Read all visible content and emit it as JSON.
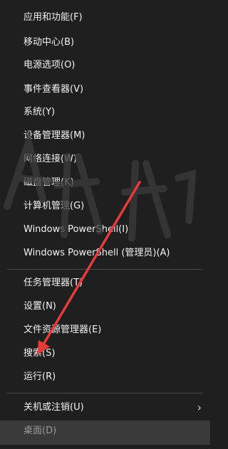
{
  "menu": {
    "items": [
      {
        "label": "应用和功能(F)"
      },
      {
        "label": "移动中心(B)"
      },
      {
        "label": "电源选项(O)"
      },
      {
        "label": "事件查看器(V)"
      },
      {
        "label": "系统(Y)"
      },
      {
        "label": "设备管理器(M)"
      },
      {
        "label": "网络连接(W)"
      },
      {
        "label": "磁盘管理(K)"
      },
      {
        "label": "计算机管理(G)"
      },
      {
        "label": "Windows PowerShell(I)"
      },
      {
        "label": "Windows PowerShell (管理员)(A)"
      },
      {
        "label": "任务管理器(T)"
      },
      {
        "label": "设置(N)"
      },
      {
        "label": "文件资源管理器(E)"
      },
      {
        "label": "搜索(S)"
      },
      {
        "label": "运行(R)"
      },
      {
        "label": "关机或注销(U)"
      },
      {
        "label": "桌面(D)"
      }
    ]
  },
  "colors": {
    "background": "#1f1f1f",
    "text": "#f2f2f2",
    "separator": "#4a4a4a",
    "highlight_bar": "#3a3a3a",
    "annotation_arrow": "#e63b3b"
  },
  "icons": {
    "submenu": "chevron-right-icon"
  }
}
